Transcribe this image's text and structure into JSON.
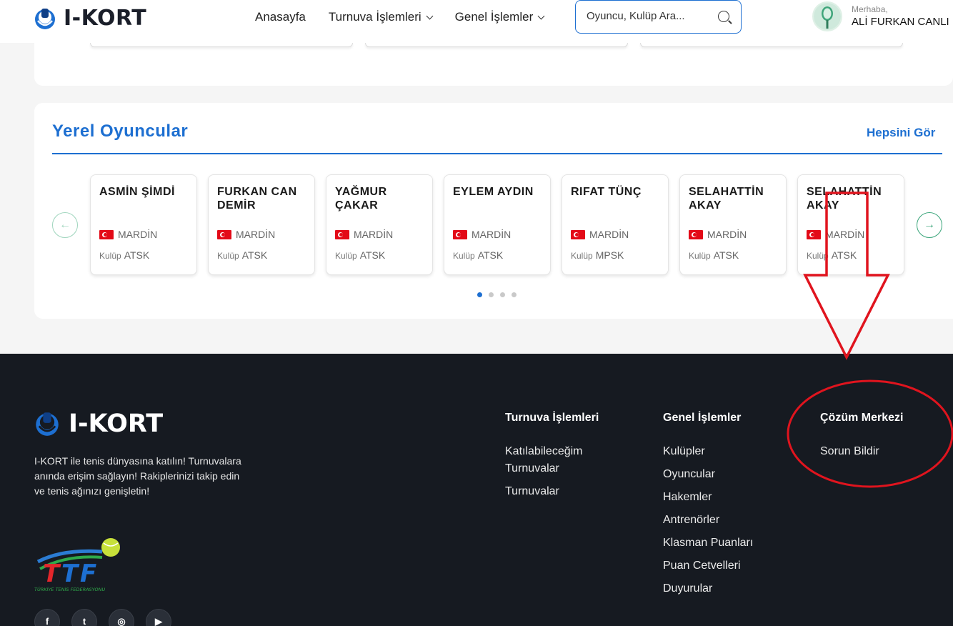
{
  "header": {
    "logo_text": "I-KORT",
    "nav": [
      {
        "label": "Anasayfa",
        "dropdown": false
      },
      {
        "label": "Turnuva İşlemleri",
        "dropdown": true
      },
      {
        "label": "Genel İşlemler",
        "dropdown": true
      }
    ],
    "search_placeholder": "Oyuncu, Kulüp Ara...",
    "greeting": "Merhaba,",
    "user_name": "ALİ FURKAN CANLI"
  },
  "local_players": {
    "title": "Yerel Oyuncular",
    "see_all": "Hepsini Gör",
    "club_prefix": "Kulüp",
    "players": [
      {
        "name": "ASMİN ŞİMDİ",
        "city": "MARDİN",
        "club": "ATSK"
      },
      {
        "name": "FURKAN CAN DEMİR",
        "city": "MARDİN",
        "club": "ATSK"
      },
      {
        "name": "YAĞMUR ÇAKAR",
        "city": "MARDİN",
        "club": "ATSK"
      },
      {
        "name": "EYLEM AYDIN",
        "city": "MARDİN",
        "club": "ATSK"
      },
      {
        "name": "RIFAT TÜNÇ",
        "city": "MARDİN",
        "club": "MPSK"
      },
      {
        "name": "SELAHATTİN AKAY",
        "city": "MARDİN",
        "club": "ATSK"
      },
      {
        "name": "SELAHATTİN AKAY",
        "city": "MARDİN",
        "club": "ATSK"
      }
    ],
    "page_count": 4,
    "active_page": 1
  },
  "footer": {
    "logo_text": "I-KORT",
    "about": "I-KORT ile tenis dünyasına katılın! Turnuvalara anında erişim sağlayın! Rakiplerinizi takip edin ve tenis ağınızı genişletin!",
    "ttf_caption": "TÜRKİYE TENİS FEDERASYONU",
    "col1": {
      "title": "Turnuva İşlemleri",
      "links": [
        "Katılabileceğim Turnuvalar",
        "Turnuvalar"
      ]
    },
    "col2": {
      "title": "Genel İşlemler",
      "links": [
        "Kulüpler",
        "Oyuncular",
        "Hakemler",
        "Antrenörler",
        "Klasman Puanları",
        "Puan Cetvelleri",
        "Duyurular"
      ]
    },
    "col3": {
      "title": "Çözüm Merkezi",
      "links": [
        "Sorun Bildir"
      ]
    },
    "socials": [
      "facebook-icon",
      "twitter-icon",
      "instagram-icon",
      "youtube-icon"
    ]
  },
  "colors": {
    "brand_blue": "#1d6fd1",
    "footer_bg": "#161a21",
    "annotation_red": "#e0141e"
  }
}
